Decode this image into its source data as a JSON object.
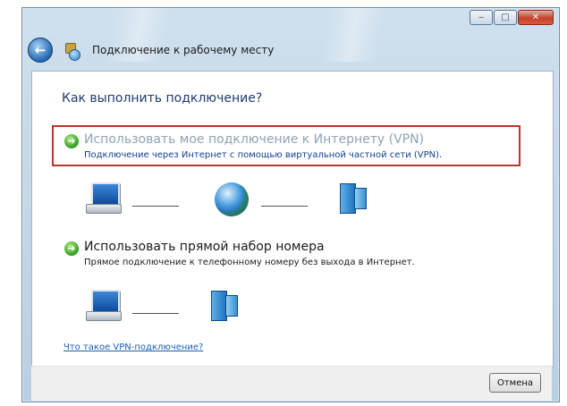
{
  "window": {
    "title": "Подключение к рабочему месту",
    "caption": {
      "minimize": "‒",
      "maximize": "□",
      "close": "✕"
    }
  },
  "main": {
    "heading": "Как выполнить подключение?",
    "options": [
      {
        "title": "Использовать мое подключение к Интернету (VPN)",
        "description": "Подключение через Интернет с помощью виртуальной частной сети (VPN).",
        "highlighted": true
      },
      {
        "title": "Использовать прямой набор номера",
        "description": "Прямое подключение к телефонному номеру без выхода в Интернет.",
        "highlighted": false
      }
    ],
    "help_link": "Что такое VPN-подключение?"
  },
  "footer": {
    "cancel_label": "Отмена"
  },
  "icons": {
    "back": "back-arrow-icon",
    "window": "network-connection-icon",
    "option_arrow": "green-arrow-icon",
    "computer": "computer-icon",
    "internet": "globe-icon",
    "server": "server-icon"
  },
  "colors": {
    "highlight_border": "#c0322e",
    "link": "#1a5fb4",
    "heading": "#1e3b73"
  }
}
